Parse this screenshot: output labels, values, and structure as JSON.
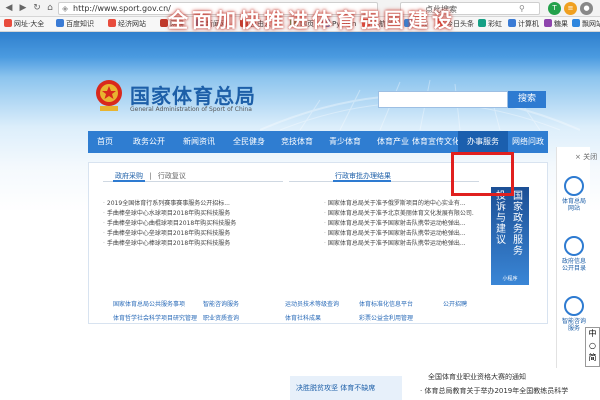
{
  "browser": {
    "url": "http://www.sport.gov.cn/",
    "search_text": "点此搜索",
    "bookmarks": [
      "网址·大全",
      "百度知识",
      "经济网站",
      "网易",
      "新闻网",
      "自由人",
      "网页",
      "Python",
      "导航栏",
      "在线",
      "今日头条",
      "彩虹",
      "计算机",
      "糖果",
      "飘网站"
    ]
  },
  "header": {
    "banner": "全面加快推进体育强国建设",
    "title": "国家体育总局",
    "subtitle": "General Administration of Sport of China",
    "search_button": "搜索"
  },
  "nav": {
    "items": [
      "首页",
      "政务公开",
      "新闻资讯",
      "全民健身",
      "竞技体育",
      "青少体育",
      "体育产业",
      "体育宣传文化",
      "办事服务",
      "网络问政"
    ],
    "highlighted": "办事服务"
  },
  "panel": {
    "left_tabs": [
      "政府采购",
      "|",
      "行政复议"
    ],
    "right_tab": "行政审批办理结果",
    "left_list": [
      "2019全国体育行系列赛事赛事服务公开招标...",
      "手曲棒垒球中心水球项目2018年购买科技服务",
      "手曲棒垒球中心曲棍球项目2018年购买科技服务",
      "手曲棒垒球中心垒球项目2018年购买科技服务",
      "手曲棒垒球中心棒球项目2018年购买科技服务"
    ],
    "right_list": [
      "国家体育总局关于准予俄罗斯项目的地中心实业有...",
      "国家体育总局关于准予北京美丽体育文化发展有限公司...",
      "国家体育总局关于准予国家射击队携带运动枪弹出...",
      "国家体育总局关于准予国家射击队携带运动枪弹出...",
      "国家体育总局关于准予国家射击队携带运动枪弹出..."
    ],
    "vbanner_col1": "国家政务服务",
    "vbanner_col2": "投诉与建议",
    "vbanner_small": "小程序",
    "links_row1": [
      "国家体育总局公共服务事项",
      "智能咨询服务",
      "运动员技术等级查询",
      "体育标准化信息平台",
      "公开招聘"
    ],
    "links_row2": [
      "体育哲学社会科学项目研究管理",
      "职业资质查询",
      "体育社科成果",
      "彩票公益金利用管理"
    ]
  },
  "sidebar": {
    "close": "关闭",
    "items": [
      "体育总局网站",
      "政府信息公开目录",
      "智能咨询服务"
    ]
  },
  "float_badge": "中\n○\n简",
  "bottom": {
    "left": "决胜脱贫攻坚  体育不缺席",
    "right1": "全国体育业职业资格大赛的通知",
    "right2": "· 体育总局教育关于举办2019年全国教练员科学"
  },
  "colors": {
    "accent": "#2e7bd1",
    "highlight_box": "#e0201f",
    "title": "#1d5fa8"
  }
}
